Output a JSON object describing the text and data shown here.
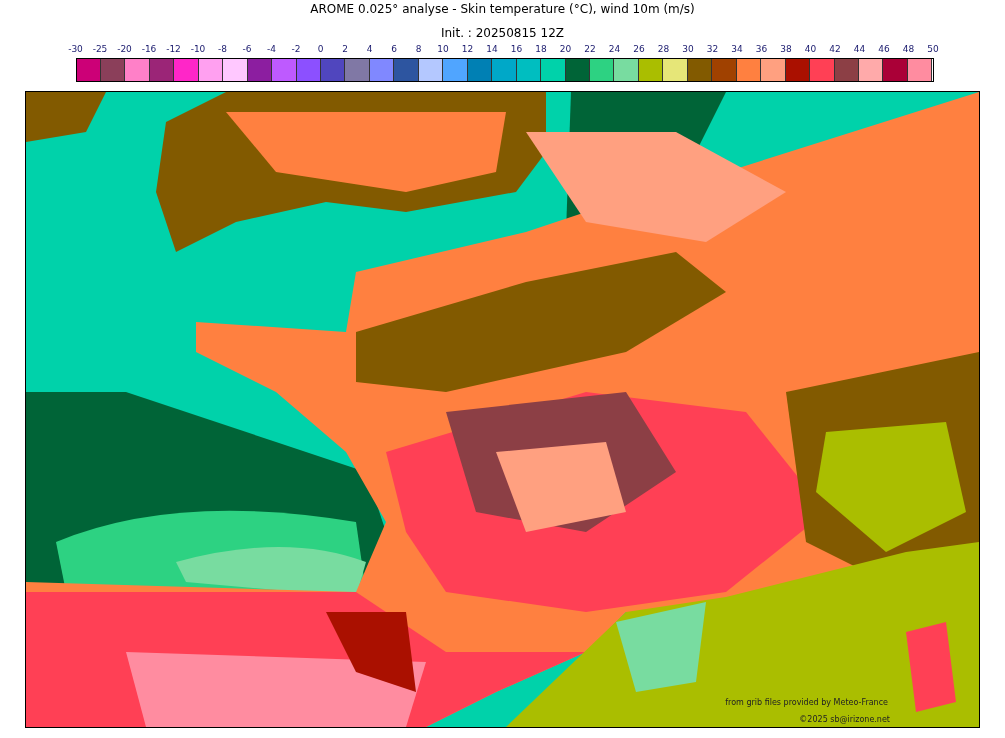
{
  "title": "AROME 0.025° analyse - Skin temperature (°C), wind 10m (m/s)",
  "subtitle": "Init. : 20250815 12Z",
  "colorbar": {
    "ticks": [
      "-30",
      "-25",
      "-20",
      "-16",
      "-12",
      "-10",
      "-8",
      "-6",
      "-4",
      "-2",
      "0",
      "2",
      "4",
      "6",
      "8",
      "10",
      "12",
      "14",
      "16",
      "18",
      "20",
      "22",
      "24",
      "26",
      "28",
      "30",
      "32",
      "34",
      "36",
      "38",
      "40",
      "42",
      "44",
      "46",
      "48",
      "50"
    ],
    "swatches": [
      {
        "color": "#cc0077"
      },
      {
        "color": "#8b3f5a"
      },
      {
        "color": "#ff80c8"
      },
      {
        "color": "#9b2577"
      },
      {
        "color": "#ff26c8"
      },
      {
        "color": "#ffa0f0"
      },
      {
        "color": "#ffc8ff"
      },
      {
        "color": "#8c1ea0"
      },
      {
        "color": "#be5aff"
      },
      {
        "color": "#8c50ff"
      },
      {
        "color": "#5046be"
      },
      {
        "color": "#8078a5"
      },
      {
        "color": "#8088ff"
      },
      {
        "color": "#2d55a0"
      },
      {
        "color": "#b4c8ff"
      },
      {
        "color": "#50a5ff"
      },
      {
        "color": "#0080b4"
      },
      {
        "color": "#00a8c8"
      },
      {
        "color": "#00bec0"
      },
      {
        "color": "#00d2aa"
      },
      {
        "color": "#006437"
      },
      {
        "color": "#2dd282"
      },
      {
        "color": "#78dca0"
      },
      {
        "color": "#aabe00"
      },
      {
        "color": "#e6e678"
      },
      {
        "color": "#825a00"
      },
      {
        "color": "#a04100"
      },
      {
        "color": "#ff8040"
      },
      {
        "color": "#ffa080"
      },
      {
        "color": "#aa1000"
      },
      {
        "color": "#ff4055"
      },
      {
        "color": "#8c3f45"
      },
      {
        "color": "#ffaaaa"
      },
      {
        "color": "#aa0037"
      },
      {
        "color": "#ff8ca0"
      }
    ]
  },
  "map": {
    "credit": "from grib files provided by Meteo-France",
    "copyright": "©2025 sb@irizone.net"
  }
}
